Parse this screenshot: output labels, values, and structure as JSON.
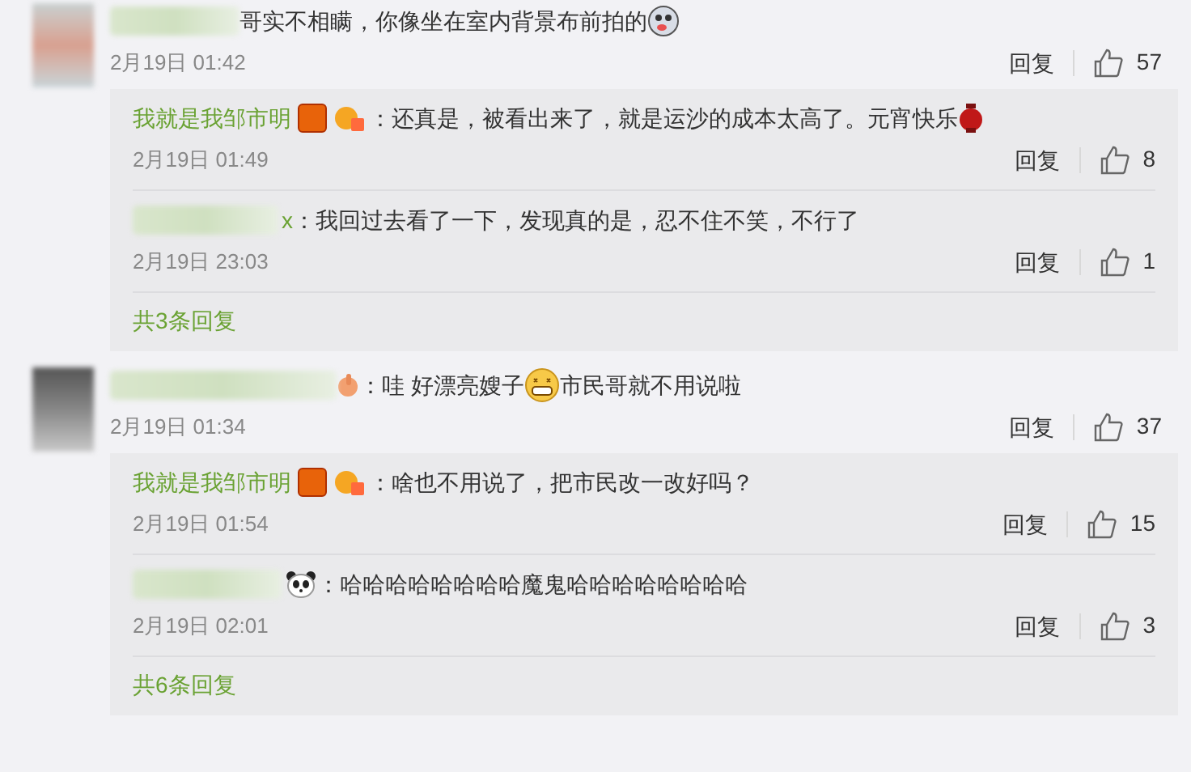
{
  "comments": [
    {
      "avatar": {
        "kind": "light"
      },
      "parts": [
        {
          "kind": "text",
          "text": "哥实不相瞒，你像坐在室内背景布前拍的"
        },
        {
          "kind": "grimace"
        }
      ],
      "time": "2月19日 01:42",
      "reply": "回复",
      "likes": "57",
      "replies": [
        {
          "kind": "named",
          "name": "我就是我邹市明",
          "parts": [
            {
              "kind": "text",
              "text": "：还真是，被看出来了，就是运沙的成本太高了。元宵快乐"
            },
            {
              "kind": "lantern"
            }
          ],
          "time": "2月19日 01:49",
          "reply": "回复",
          "likes": "8"
        },
        {
          "kind": "blurred",
          "name": "x",
          "parts": [
            {
              "kind": "text",
              "text": "：我回过去看了一下，发现真的是，忍不住不笑，不行了"
            }
          ],
          "time": "2月19日 23:03",
          "reply": "回复",
          "likes": "1"
        }
      ],
      "more": "共3条回复"
    },
    {
      "avatar": {
        "kind": "dark"
      },
      "name_icon": {
        "kind": "hand"
      },
      "parts": [
        {
          "kind": "text",
          "text": "：哇 好漂亮嫂子"
        },
        {
          "kind": "grin"
        },
        {
          "kind": "text",
          "text": "市民哥就不用说啦"
        }
      ],
      "time": "2月19日 01:34",
      "reply": "回复",
      "likes": "37",
      "replies": [
        {
          "kind": "named",
          "name": "我就是我邹市明",
          "parts": [
            {
              "kind": "text",
              "text": "：啥也不用说了，把市民改一改好吗？"
            }
          ],
          "time": "2月19日 01:54",
          "reply": "回复",
          "likes": "15"
        },
        {
          "kind": "blurred",
          "name_icon": {
            "kind": "panda"
          },
          "parts": [
            {
              "kind": "text",
              "text": "：哈哈哈哈哈哈哈哈魔鬼哈哈哈哈哈哈哈哈"
            }
          ],
          "time": "2月19日 02:01",
          "reply": "回复",
          "likes": "3"
        }
      ],
      "more": "共6条回复"
    }
  ]
}
